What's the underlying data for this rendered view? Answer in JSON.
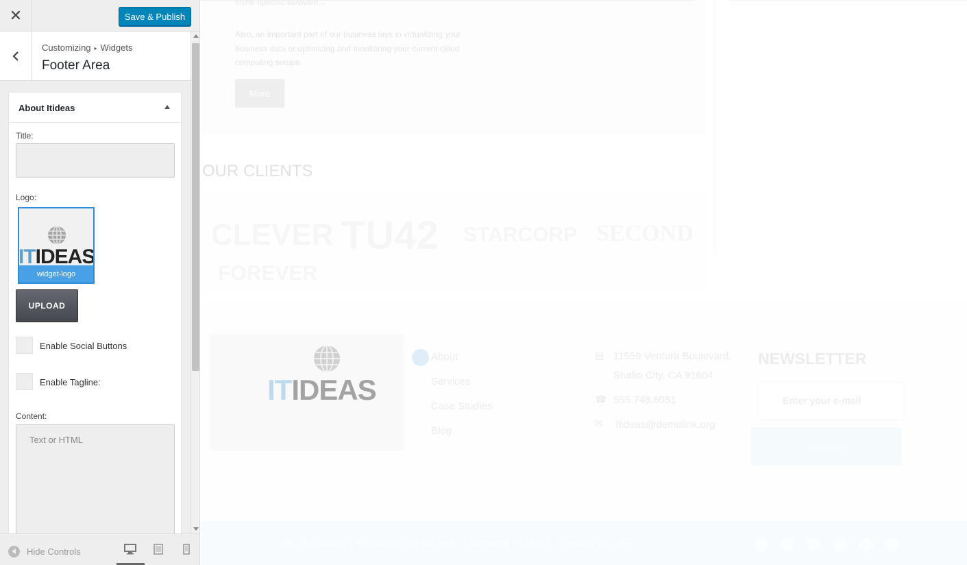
{
  "customizer": {
    "close_label": "✕",
    "save_label": "Save & Publish",
    "breadcrumb": [
      "Customizing",
      "Widgets"
    ],
    "breadcrumb_sep": "▸",
    "section_title": "Footer Area",
    "widget": {
      "title": "About Itideas",
      "title_field_label": "Title:",
      "title_value": "",
      "logo_label": "Logo:",
      "logo_caption": "widget-logo",
      "logo_text_it": "IT",
      "logo_text_ideas": "IDEAS",
      "upload_label": "UPLOAD",
      "social_label": "Enable Social Buttons",
      "tagline_label": "Enable Tagline:",
      "content_label": "Content:",
      "content_placeholder": "Text or HTML"
    },
    "hide_controls": "Hide Controls",
    "devices": [
      "desktop-icon",
      "tablet-icon",
      "mobile-icon"
    ],
    "colors": {
      "primary": "#0085ba",
      "logo_select": "#2e8bd8"
    }
  },
  "preview": {
    "services": {
      "p1": "niche-specific software...",
      "p2": "Also, an important part of our business lays in virtualizing your business data or optimizing and monitoring your current cloud computing setups.",
      "more_label": "More"
    },
    "clients_title": "OUR CLIENTS",
    "clients": [
      "CLEVER",
      "TU42",
      "STARCORP",
      "SECOND",
      "FOREVER"
    ],
    "footer": {
      "logo_it": "IT",
      "logo_ideas": "IDEAS",
      "links": [
        "About",
        "Services",
        "Case Studies",
        "Blog"
      ],
      "address_line1": "11559 Ventura Boulevard,",
      "address_line2": "Studio City, CA 91604",
      "phone": "555.748.6051",
      "email": "Itideas@demolink.org",
      "newsletter_title": "NEWSLETTER",
      "newsletter_placeholder": "Enter your e-mail",
      "subscribe_label": "Subscribe"
    },
    "copyright": {
      "text": "© 2017 ALL RIGHTS RESERVED BY ITIDEAS",
      "privacy": "PRIVACY POLICY",
      "terms": "TERMS OF USE"
    },
    "social_icons": [
      "facebook-icon",
      "twitter-icon",
      "google-plus-icon",
      "pinterest-icon",
      "user-icon",
      "vimeo-icon"
    ]
  }
}
